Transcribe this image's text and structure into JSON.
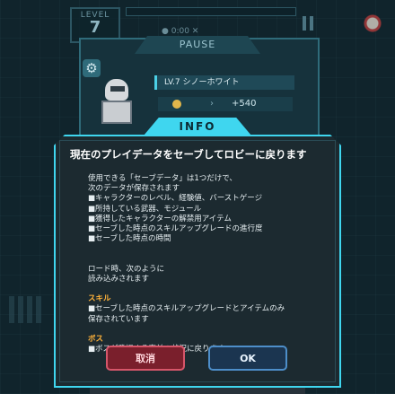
{
  "hud": {
    "level_label": "LEVEL",
    "level_value": "7",
    "stats_text": "● 0:00  ✕"
  },
  "pause_panel": {
    "title": "PAUSE",
    "character_name": "LV.7 シノーホワイト",
    "gold_gain": "+540",
    "gold_arrow": "›"
  },
  "info_dialog": {
    "tab_label": "INFO",
    "heading": "現在のプレイデータをセーブしてロビーに戻ります",
    "body_lines": [
      "使用できる「セーブデータ」は1つだけで、",
      "次のデータが保存されます",
      "■キャラクターのレベル、経験値、バーストゲージ",
      "■所持している武器、モジュール",
      "■獲得したキャラクターの解禁用アイテム",
      "■セーブした時点のスキルアップグレードの進行度",
      "■セーブした時点の時間"
    ],
    "load_lines": [
      "ロード時、次のように",
      "読み込みされます"
    ],
    "skill_heading": "スキル",
    "skill_lines": [
      "■セーブした時点のスキルアップグレードとアイテムのみ",
      "保存されています"
    ],
    "boss_heading": "ボス",
    "boss_lines": [
      "■ボスが登場する直前の状況に戻ります"
    ],
    "cancel_label": "取消",
    "ok_label": "OK"
  },
  "colors": {
    "accent": "#3fd6ef",
    "highlight": "#ffb23a",
    "cancel": "#d6566a",
    "ok": "#4d8ec9"
  },
  "icons": {
    "settings": "gear-icon",
    "pause": "pause-icon",
    "gold": "coin-icon"
  }
}
